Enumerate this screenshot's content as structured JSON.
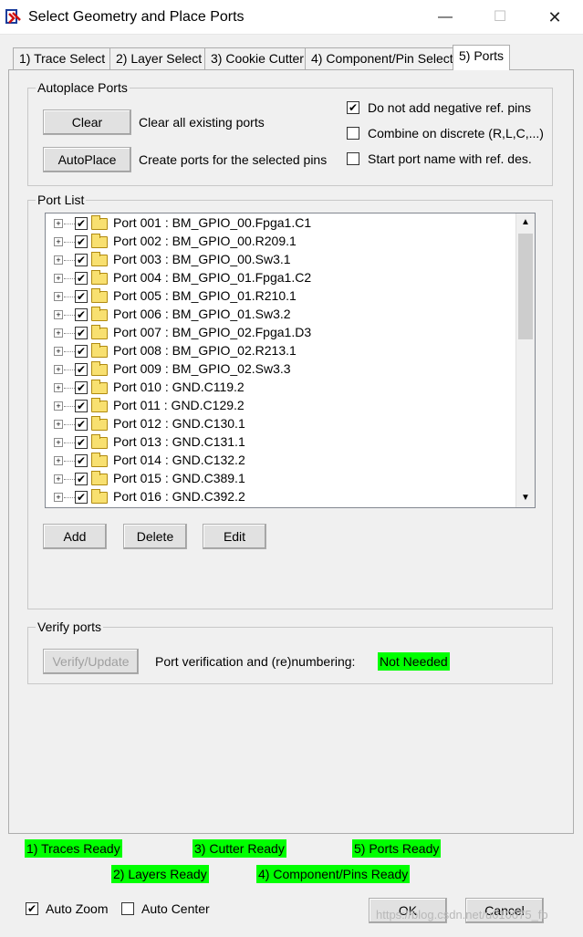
{
  "window": {
    "title": "Select Geometry and Place Ports",
    "minimize": "—",
    "maximize": "☐",
    "close": "✕"
  },
  "tabs": [
    {
      "label": "1) Trace Select"
    },
    {
      "label": "2) Layer Select"
    },
    {
      "label": "3) Cookie Cutter"
    },
    {
      "label": "4) Component/Pin Select"
    },
    {
      "label": "5) Ports"
    }
  ],
  "active_tab": "5) Ports",
  "autoplace": {
    "title": "Autoplace Ports",
    "clear_button": "Clear",
    "clear_desc": "Clear all existing ports",
    "autoplace_button": "AutoPlace",
    "autoplace_desc": "Create ports for the selected pins",
    "options": [
      {
        "label": "Do not add negative ref. pins",
        "checked": true
      },
      {
        "label": "Combine on discrete (R,L,C,...)",
        "checked": false
      },
      {
        "label": "Start port name with ref. des.",
        "checked": false
      }
    ]
  },
  "port_list": {
    "title": "Port List",
    "items": [
      "Port 001 : BM_GPIO_00.Fpga1.C1",
      "Port 002 : BM_GPIO_00.R209.1",
      "Port 003 : BM_GPIO_00.Sw3.1",
      "Port 004 : BM_GPIO_01.Fpga1.C2",
      "Port 005 : BM_GPIO_01.R210.1",
      "Port 006 : BM_GPIO_01.Sw3.2",
      "Port 007 : BM_GPIO_02.Fpga1.D3",
      "Port 008 : BM_GPIO_02.R213.1",
      "Port 009 : BM_GPIO_02.Sw3.3",
      "Port 010 : GND.C119.2",
      "Port 011 : GND.C129.2",
      "Port 012 : GND.C130.1",
      "Port 013 : GND.C131.1",
      "Port 014 : GND.C132.2",
      "Port 015 : GND.C389.1",
      "Port 016 : GND.C392.2"
    ],
    "add_button": "Add",
    "delete_button": "Delete",
    "edit_button": "Edit"
  },
  "verify": {
    "title": "Verify ports",
    "button": "Verify/Update",
    "label": "Port verification and (re)numbering:",
    "status": "Not Needed"
  },
  "status": {
    "traces": "1) Traces Ready",
    "layers": "2) Layers Ready",
    "cutter": "3) Cutter Ready",
    "component_pins": "4) Component/Pins Ready",
    "ports": "5) Ports Ready"
  },
  "bottom": {
    "auto_zoom": "Auto Zoom",
    "auto_zoom_checked": true,
    "auto_center": "Auto Center",
    "auto_center_checked": false,
    "ok": "OK",
    "cancel": "Cancel"
  },
  "watermark": "https://blog.csdn.net/u010075_fb",
  "colors": {
    "status_green": "#00ff00",
    "folder_yellow": "#f8e070"
  }
}
